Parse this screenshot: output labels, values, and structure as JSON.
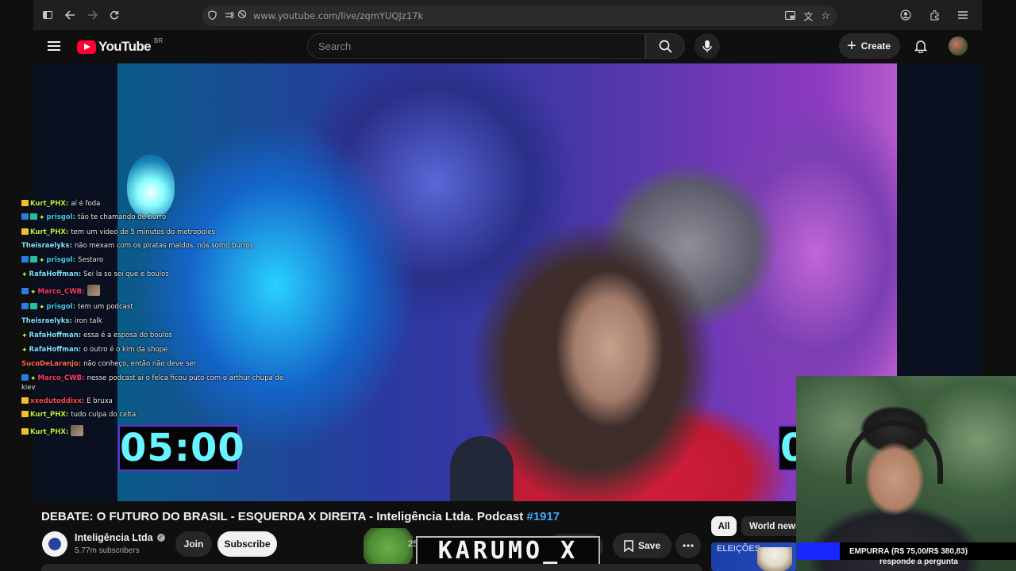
{
  "browser": {
    "url": "www.youtube.com/live/zqmYUQJz17k"
  },
  "header": {
    "logo_text": "YouTube",
    "country": "BR",
    "search_placeholder": "Search",
    "create_label": "Create"
  },
  "video": {
    "timer_left": "05:00",
    "timer_right": "0"
  },
  "chat": [
    {
      "user": "Kurt_PHX",
      "color": "#b6f23a",
      "badges": [
        "crown"
      ],
      "text": "aí é foda"
    },
    {
      "user": "prisgol",
      "color": "#3ecff0",
      "badges": [
        "mod",
        "sub",
        "star"
      ],
      "text": "tão te chamando de burro"
    },
    {
      "user": "Kurt_PHX",
      "color": "#b6f23a",
      "badges": [
        "crown"
      ],
      "text": "tem um video de 5 minutos do metropoles"
    },
    {
      "user": "Theisraelyks",
      "color": "#7fe0ff",
      "badges": [],
      "text": "não mexam com os piratas maldos. nós somo burros"
    },
    {
      "user": "prisgol",
      "color": "#3ecff0",
      "badges": [
        "mod",
        "sub",
        "star"
      ],
      "text": "Sestaro"
    },
    {
      "user": "RafaHoffman",
      "color": "#7fe0ff",
      "badges": [
        "star"
      ],
      "text": "Sei la so sei que e boulos"
    },
    {
      "user": "Marco_CWB",
      "color": "#ff3a6a",
      "badges": [
        "mod",
        "star"
      ],
      "text": ""
    },
    {
      "user": "prisgol",
      "color": "#3ecff0",
      "badges": [
        "mod",
        "sub",
        "star"
      ],
      "text": "tem um podcast"
    },
    {
      "user": "Theisraelyks",
      "color": "#7fe0ff",
      "badges": [],
      "text": "iron talk"
    },
    {
      "user": "RafaHoffman",
      "color": "#7fe0ff",
      "badges": [
        "star"
      ],
      "text": "essa é a esposa do boulos"
    },
    {
      "user": "RafaHoffman",
      "color": "#7fe0ff",
      "badges": [
        "star"
      ],
      "text": "o outro é o kim da shope"
    },
    {
      "user": "SucoDeLaranjo",
      "color": "#ff6a4a",
      "badges": [],
      "text": "não conheço, então não deve ser"
    },
    {
      "user": "Marco_CWB",
      "color": "#ff3a6a",
      "badges": [
        "mod",
        "star"
      ],
      "text": "nesse podcast ai o felca ficou puto com o arthur chupa de kiev"
    },
    {
      "user": "xxedutoddixx",
      "color": "#ff4a4a",
      "badges": [
        "crown"
      ],
      "text": "E bruxa"
    },
    {
      "user": "Kurt_PHX",
      "color": "#b6f23a",
      "badges": [
        "crown"
      ],
      "text": "tudo culpa do celta"
    },
    {
      "user": "Kurt_PHX",
      "color": "#b6f23a",
      "badges": [
        "crown"
      ],
      "text": ""
    }
  ],
  "title": {
    "text": "DEBATE: O FUTURO DO BRASIL - ESQUERDA X DIREITA - Inteligência Ltda. Podcast ",
    "hashtag": "#1917"
  },
  "channel": {
    "name": "Inteligência Ltda",
    "subscribers": "5.77m subscribers",
    "join_label": "Join",
    "subscribe_label": "Subscribe"
  },
  "actions": {
    "like_count": "25",
    "save_label": "Save"
  },
  "overlay": {
    "karumo_text": "KARUMO_X",
    "donation": "EMPURRA (R$ 75,00/R$ 380,83)",
    "donation_sub": "responde a pergunta"
  },
  "chips": {
    "all": "All",
    "world_news": "World news"
  },
  "recommendation": {
    "thumb_text": "ELEIÇÕES"
  }
}
